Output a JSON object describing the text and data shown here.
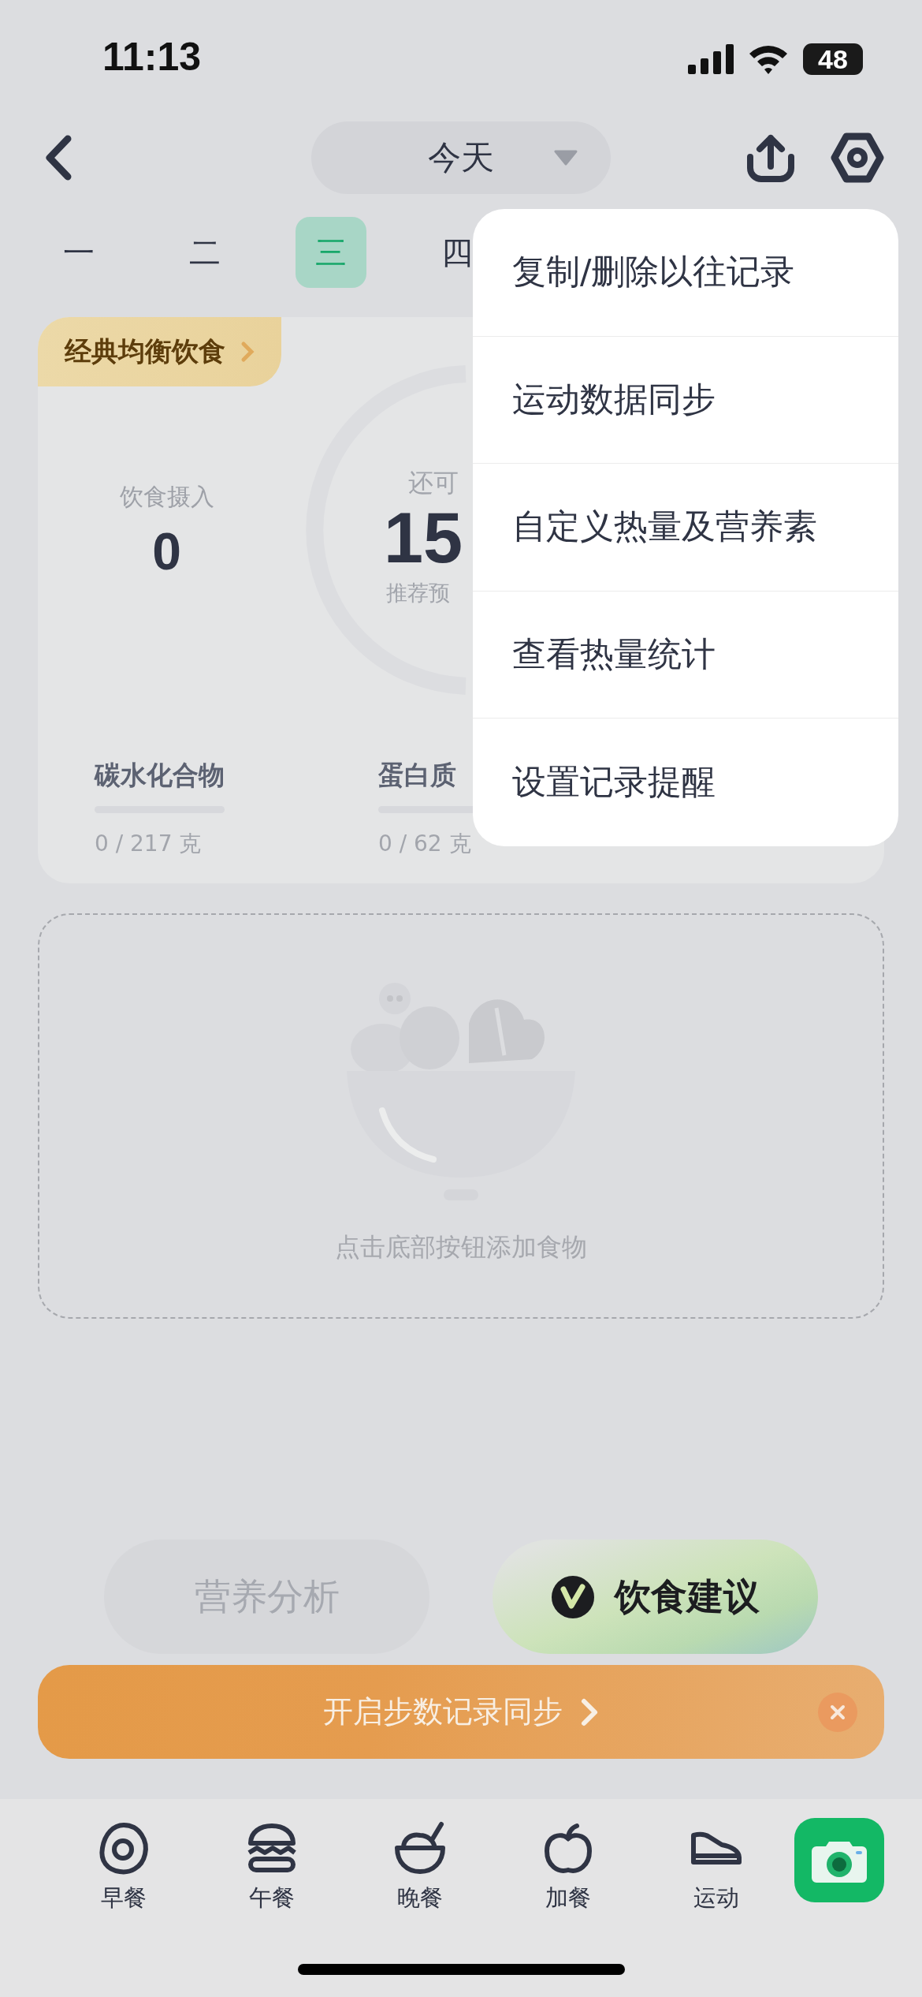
{
  "status_bar": {
    "time": "11:13",
    "battery": "48"
  },
  "nav": {
    "title": "今天"
  },
  "weekdays": [
    {
      "label": "一",
      "selected": false
    },
    {
      "label": "二",
      "selected": false
    },
    {
      "label": "三",
      "selected": true
    },
    {
      "label": "四",
      "selected": false
    }
  ],
  "card": {
    "tag": "经典均衡饮食",
    "intake": {
      "label": "饮食摄入",
      "value": "0"
    },
    "remaining": {
      "label": "还可",
      "value": "15",
      "caption": "推荐预"
    },
    "macros": [
      {
        "name": "碳水化合物",
        "level": 0,
        "reading": "0 / 217 克"
      },
      {
        "name": "蛋白质",
        "level": 0,
        "reading": "0 / 62 克"
      }
    ]
  },
  "empty_state": {
    "hint": "点击底部按钮添加食物"
  },
  "actions": [
    {
      "label": "营养分析",
      "kind": "secondary"
    },
    {
      "label": "饮食建议",
      "kind": "primary"
    }
  ],
  "banner": {
    "text": "开启步数记录同步"
  },
  "tabs": [
    {
      "label": "早餐"
    },
    {
      "label": "午餐"
    },
    {
      "label": "晚餐"
    },
    {
      "label": "加餐"
    },
    {
      "label": "运动"
    }
  ],
  "menu": {
    "items": [
      "复制/删除以往记录",
      "运动数据同步",
      "自定义热量及营养素",
      "查看热量统计",
      "设置记录提醒"
    ]
  }
}
